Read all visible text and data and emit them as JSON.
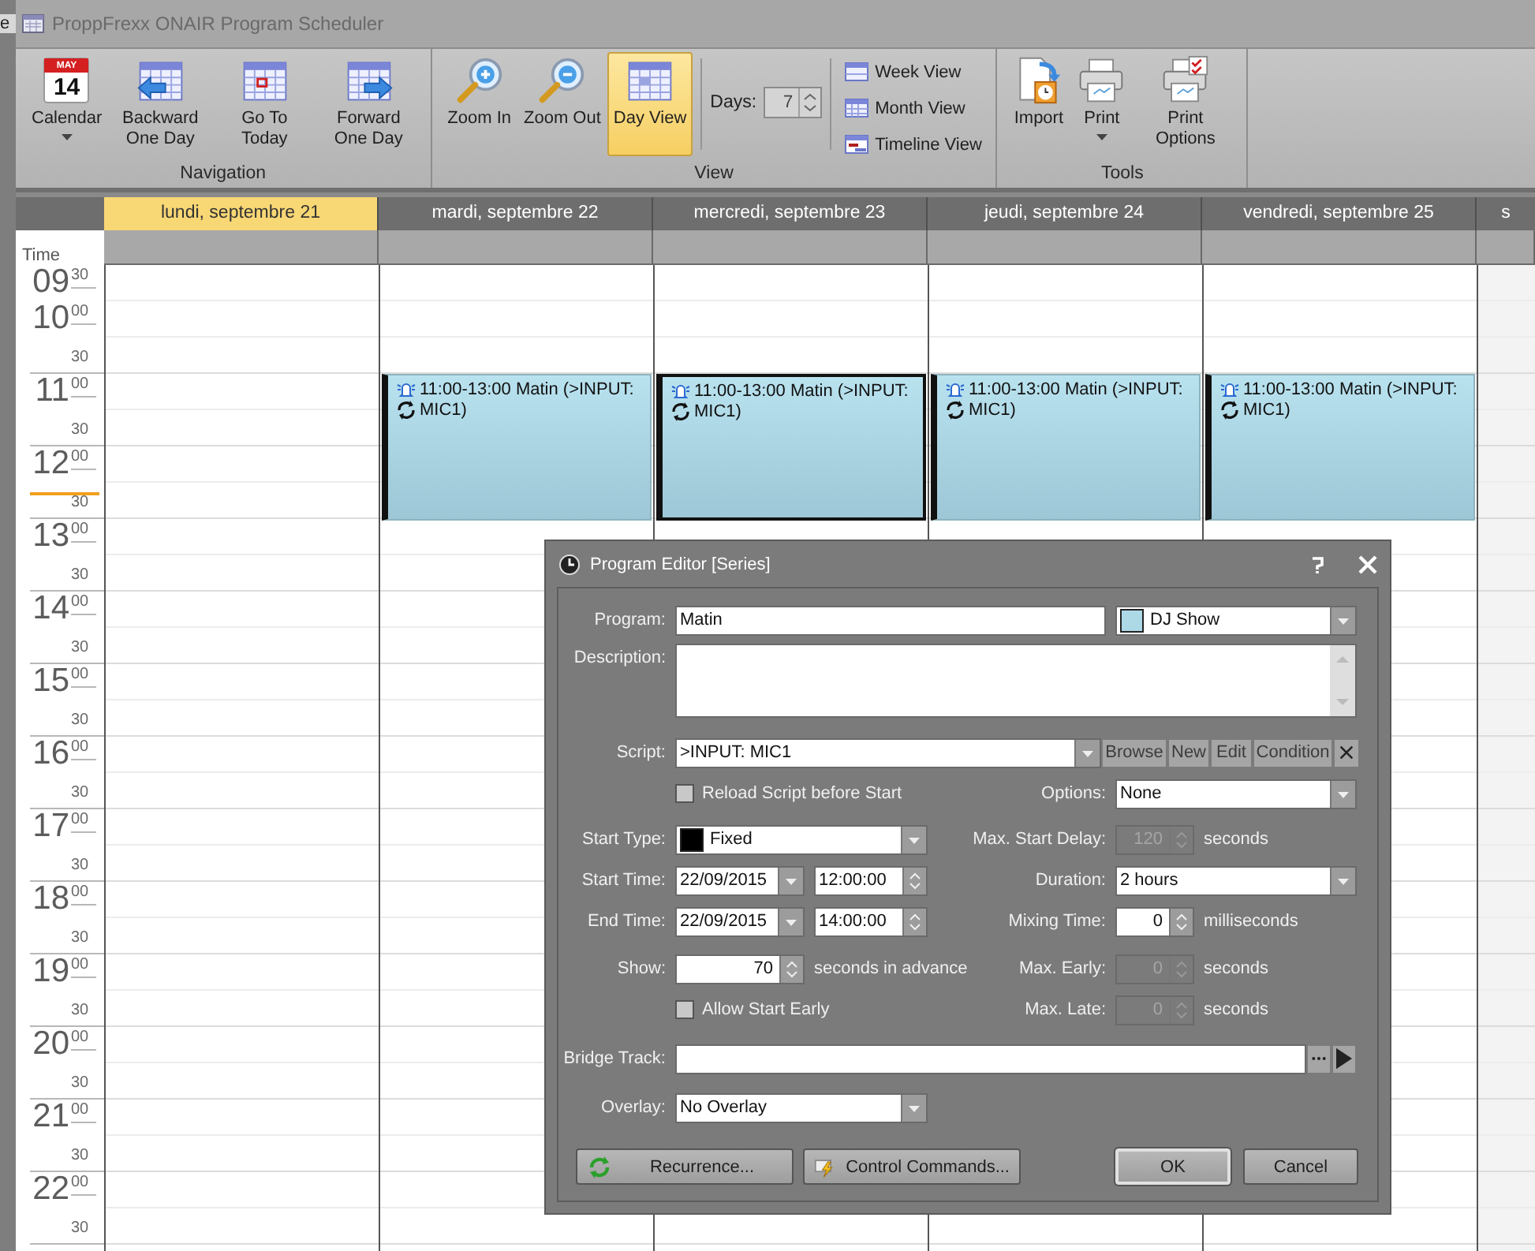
{
  "background_window": {
    "text": "e"
  },
  "window": {
    "title": "ProppFrexx ONAIR Program Scheduler"
  },
  "ribbon": {
    "groups": [
      {
        "label": "Navigation",
        "items": [
          {
            "kind": "calendar",
            "label": "Calendar",
            "dropdown": true,
            "selected": false,
            "icon_month": "MAY",
            "icon_day": "14"
          },
          {
            "kind": "backward",
            "label": "Backward One Day",
            "dropdown": false,
            "selected": false
          },
          {
            "kind": "today",
            "label": "Go To Today",
            "dropdown": false,
            "selected": false
          },
          {
            "kind": "forward",
            "label": "Forward One Day",
            "dropdown": false,
            "selected": false
          }
        ]
      },
      {
        "label": "View",
        "items": [
          {
            "kind": "zoomin",
            "label": "Zoom In",
            "dropdown": false,
            "selected": false
          },
          {
            "kind": "zoomout",
            "label": "Zoom Out",
            "dropdown": false,
            "selected": false
          },
          {
            "kind": "dayview",
            "label": "Day View",
            "dropdown": false,
            "selected": true
          },
          {
            "kind": "spinner",
            "label": "Days:",
            "value": "7"
          },
          {
            "kind": "viewlist",
            "options": [
              {
                "kind": "week",
                "label": "Week View",
                "selected": false
              },
              {
                "kind": "month",
                "label": "Month View",
                "selected": false
              },
              {
                "kind": "timeline",
                "label": "Timeline View",
                "selected": false
              }
            ]
          }
        ]
      },
      {
        "label": "Tools",
        "items": [
          {
            "kind": "import",
            "label": "Import",
            "dropdown": false,
            "selected": false
          },
          {
            "kind": "print",
            "label": "Print",
            "dropdown": true,
            "selected": false
          },
          {
            "kind": "printoptions",
            "label": "Print Options",
            "dropdown": false,
            "selected": false
          }
        ]
      }
    ]
  },
  "calendar": {
    "time_header": "Time",
    "days": [
      {
        "label": "lundi, septembre 21",
        "selected": true
      },
      {
        "label": "mardi, septembre 22",
        "selected": false,
        "appointments": [
          {
            "time": "11:00-13:00",
            "title": "Matin (>INPUT: MIC1)",
            "selected": false,
            "reminder": true,
            "recurring": true
          }
        ]
      },
      {
        "label": "mercredi, septembre 23",
        "selected": false,
        "appointments": [
          {
            "time": "11:00-13:00",
            "title": "Matin (>INPUT: MIC1)",
            "selected": true,
            "reminder": true,
            "recurring": true
          }
        ]
      },
      {
        "label": "jeudi, septembre 24",
        "selected": false,
        "appointments": [
          {
            "time": "11:00-13:00",
            "title": "Matin (>INPUT: MIC1)",
            "selected": false,
            "reminder": true,
            "recurring": true
          }
        ]
      },
      {
        "label": "vendredi, septembre 25",
        "selected": false,
        "appointments": [
          {
            "time": "11:00-13:00",
            "title": "Matin (>INPUT: MIC1)",
            "selected": false,
            "reminder": true,
            "recurring": true
          }
        ]
      },
      {
        "label": "s",
        "selected": false
      }
    ],
    "time_rows": [
      {
        "hour": "09",
        "minute": "30",
        "current": false
      },
      {
        "hour": "10",
        "minute": "00",
        "current": false
      },
      {
        "minute": "30",
        "current": false
      },
      {
        "hour": "11",
        "minute": "00",
        "current": false
      },
      {
        "minute": "30",
        "current": false
      },
      {
        "hour": "12",
        "minute": "00",
        "current": false
      },
      {
        "minute": "30",
        "current": true
      },
      {
        "hour": "13",
        "minute": "00",
        "current": false
      },
      {
        "minute": "30",
        "current": false
      },
      {
        "hour": "14",
        "minute": "00",
        "current": false
      },
      {
        "minute": "30",
        "current": false
      },
      {
        "hour": "15",
        "minute": "00",
        "current": false
      },
      {
        "minute": "30",
        "current": false
      },
      {
        "hour": "16",
        "minute": "00",
        "current": false
      },
      {
        "minute": "30",
        "current": false
      },
      {
        "hour": "17",
        "minute": "00",
        "current": false
      },
      {
        "minute": "30",
        "current": false
      },
      {
        "hour": "18",
        "minute": "00",
        "current": false
      },
      {
        "minute": "30",
        "current": false
      },
      {
        "hour": "19",
        "minute": "00",
        "current": false
      },
      {
        "minute": "30",
        "current": false
      },
      {
        "hour": "20",
        "minute": "00",
        "current": false
      },
      {
        "minute": "30",
        "current": false
      },
      {
        "hour": "21",
        "minute": "00",
        "current": false
      },
      {
        "minute": "30",
        "current": false
      },
      {
        "hour": "22",
        "minute": "00",
        "current": false
      },
      {
        "minute": "30",
        "current": false
      }
    ]
  },
  "dialog": {
    "title": "Program Editor [Series]",
    "program": {
      "label": "Program:",
      "value": "Matin"
    },
    "category": {
      "value": "DJ Show",
      "color": "#add8e6"
    },
    "description": {
      "label": "Description:"
    },
    "script": {
      "label": "Script:",
      "value": ">INPUT: MIC1",
      "buttons": [
        "Browse",
        "New",
        "Edit",
        "Condition"
      ]
    },
    "reload_script": {
      "label": "Reload Script before Start",
      "checked": false
    },
    "options": {
      "label": "Options:",
      "value": "None"
    },
    "start_type": {
      "label": "Start Type:",
      "value": "Fixed",
      "color": "#000000"
    },
    "max_start_delay": {
      "label": "Max. Start Delay:",
      "value": "120",
      "unit": "seconds",
      "disabled": true
    },
    "start_time": {
      "label": "Start Time:",
      "date": "22/09/2015",
      "time": "12:00:00"
    },
    "duration": {
      "label": "Duration:",
      "value": "2 hours"
    },
    "end_time": {
      "label": "End Time:",
      "date": "22/09/2015",
      "time": "14:00:00"
    },
    "mixing_time": {
      "label": "Mixing Time:",
      "value": "0",
      "unit": "milliseconds",
      "disabled": false
    },
    "show": {
      "label": "Show:",
      "value": "70",
      "unit": "seconds in advance",
      "disabled": false
    },
    "max_early": {
      "label": "Max. Early:",
      "value": "0",
      "unit": "seconds",
      "disabled": true
    },
    "allow_start_early": {
      "label": "Allow Start Early",
      "checked": false
    },
    "max_late": {
      "label": "Max. Late:",
      "value": "0",
      "unit": "seconds",
      "disabled": true
    },
    "bridge_track": {
      "label": "Bridge Track:"
    },
    "overlay": {
      "label": "Overlay:",
      "value": "No Overlay"
    },
    "buttons": [
      {
        "kind": "recurrence",
        "label": "Recurrence...",
        "default": false
      },
      {
        "kind": "commands",
        "label": "Control Commands...",
        "default": false
      },
      {
        "kind": "ok",
        "label": "OK",
        "default": true
      },
      {
        "kind": "cancel",
        "label": "Cancel",
        "default": false
      }
    ]
  }
}
